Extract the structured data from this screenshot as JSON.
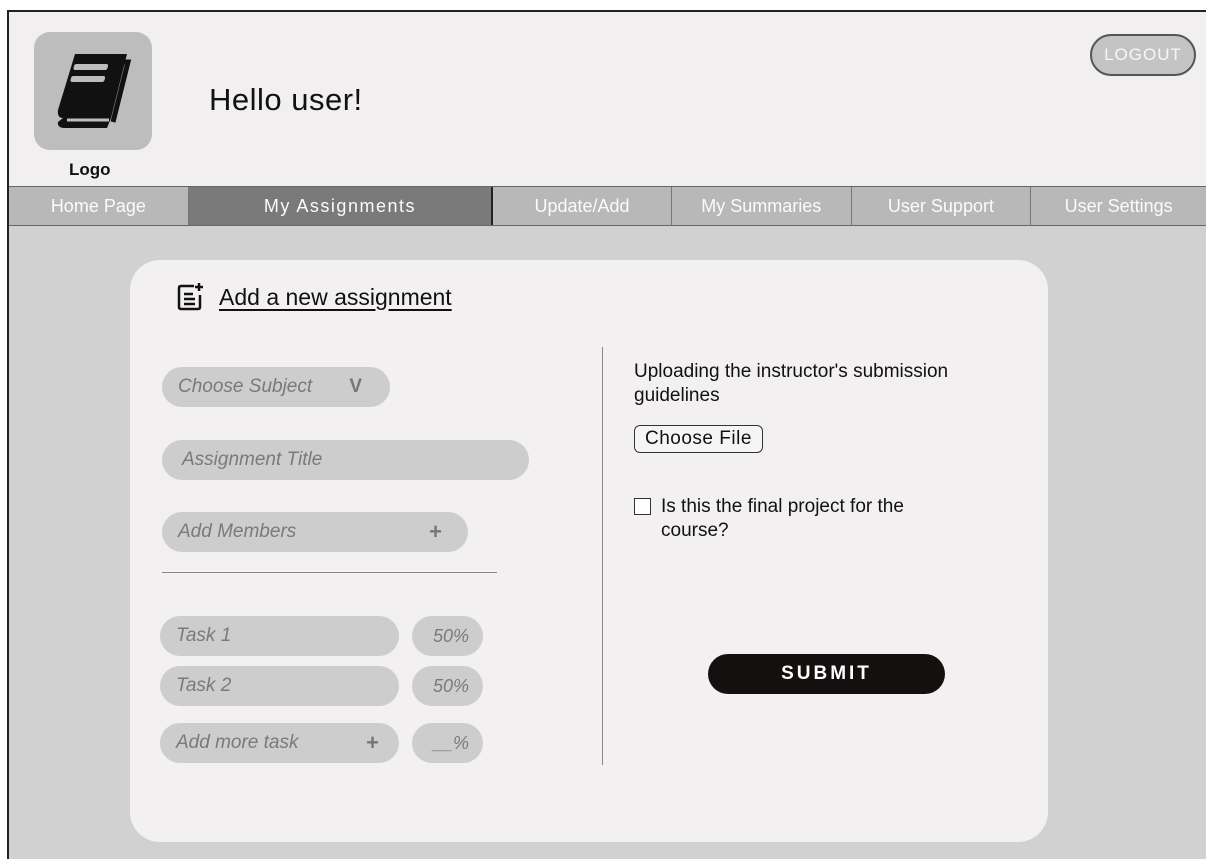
{
  "header": {
    "logo_label": "Logo",
    "greeting": "Hello user!",
    "logout_label": "LOGOUT"
  },
  "nav": {
    "items": [
      {
        "label": "Home Page"
      },
      {
        "label": "My Assignments",
        "active": true
      },
      {
        "label": "Update/Add"
      },
      {
        "label": "My Summaries"
      },
      {
        "label": "User Support"
      },
      {
        "label": "User Settings"
      }
    ]
  },
  "card": {
    "title": "Add a new assignment",
    "subject_placeholder": "Choose Subject",
    "subject_chevron": "V",
    "title_placeholder": "Assignment Title",
    "members_placeholder": "Add Members",
    "plus": "+",
    "tasks": [
      {
        "label": "Task 1",
        "percent": "50%"
      },
      {
        "label": "Task 2",
        "percent": "50%"
      }
    ],
    "add_task_placeholder": "Add more task",
    "add_task_percent": "__%",
    "upload_label": "Uploading the instructor's submission guidelines",
    "choose_file_label": "Choose File",
    "final_project_label": "Is this the final project for the course?",
    "submit_label": "SUBMIT"
  },
  "icons": {
    "logo": "book-icon",
    "title": "add-note-icon"
  }
}
